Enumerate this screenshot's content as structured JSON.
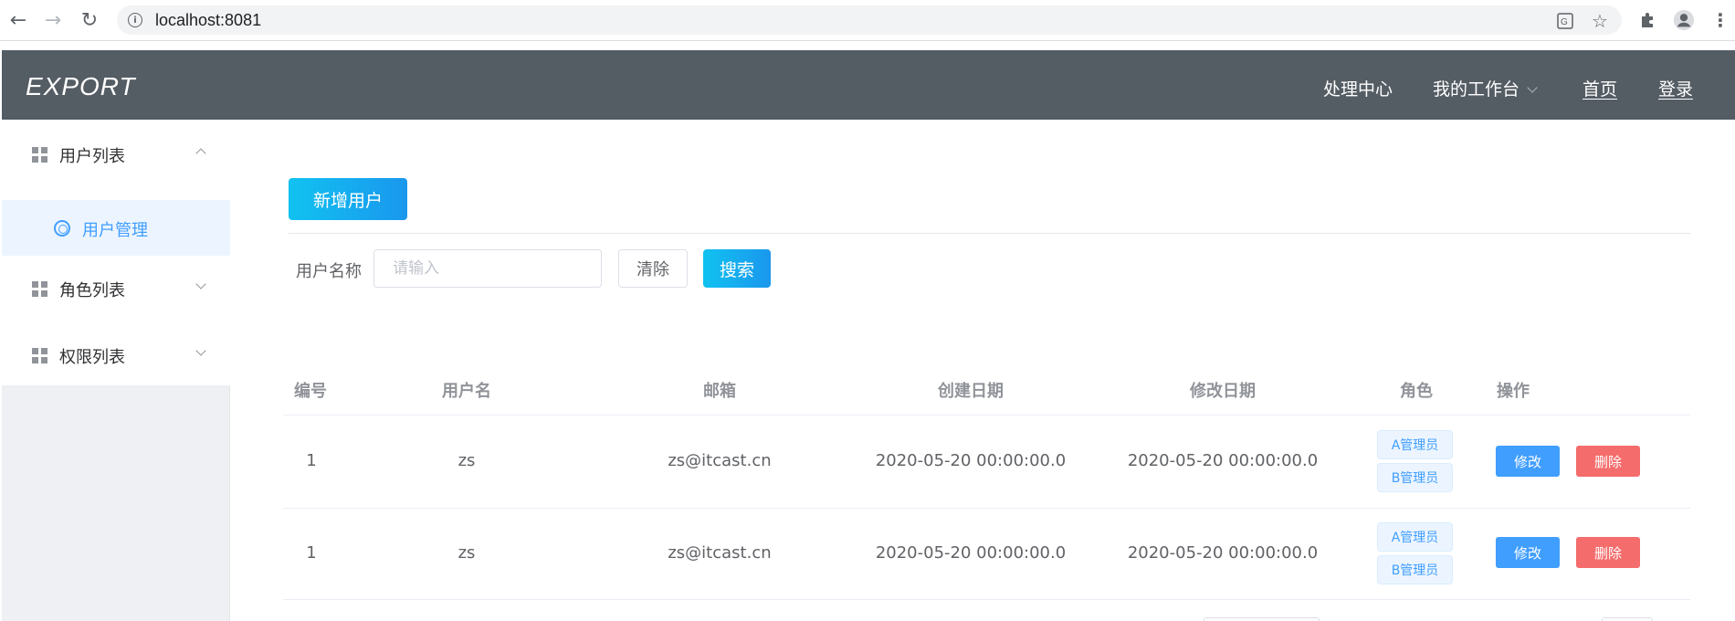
{
  "browser": {
    "url": "localhost:8081"
  },
  "header": {
    "logo": "EXPORT",
    "menu": [
      {
        "label": "处理中心"
      },
      {
        "label": "我的工作台"
      },
      {
        "label": "首页"
      },
      {
        "label": "登录"
      }
    ]
  },
  "sidebar": {
    "groups": [
      {
        "label": "用户列表",
        "expanded": true,
        "children": [
          {
            "label": "用户管理",
            "active": true
          }
        ]
      },
      {
        "label": "角色列表",
        "expanded": false
      },
      {
        "label": "权限列表",
        "expanded": false
      }
    ]
  },
  "main": {
    "add_button": "新增用户",
    "search": {
      "label": "用户名称",
      "placeholder": "请输入",
      "value": "",
      "clear_button": "清除",
      "search_button": "搜索"
    },
    "table": {
      "columns": [
        "编号",
        "用户名",
        "邮箱",
        "创建日期",
        "修改日期",
        "角色",
        "操作"
      ],
      "rows": [
        {
          "id": "1",
          "username": "zs",
          "email": "zs@itcast.cn",
          "created": "2020-05-20 00:00:00.0",
          "modified": "2020-05-20 00:00:00.0",
          "roles": [
            "A管理员",
            "B管理员"
          ],
          "edit": "修改",
          "delete": "删除"
        },
        {
          "id": "1",
          "username": "zs",
          "email": "zs@itcast.cn",
          "created": "2020-05-20 00:00:00.0",
          "modified": "2020-05-20 00:00:00.0",
          "roles": [
            "A管理员",
            "B管理员"
          ],
          "edit": "修改",
          "delete": "删除"
        }
      ]
    }
  },
  "colors": {
    "header_bg": "#545c64",
    "primary": "#409eff",
    "danger": "#f56c6c",
    "gradient_start": "#11c2f0",
    "gradient_end": "#1a97ee"
  }
}
